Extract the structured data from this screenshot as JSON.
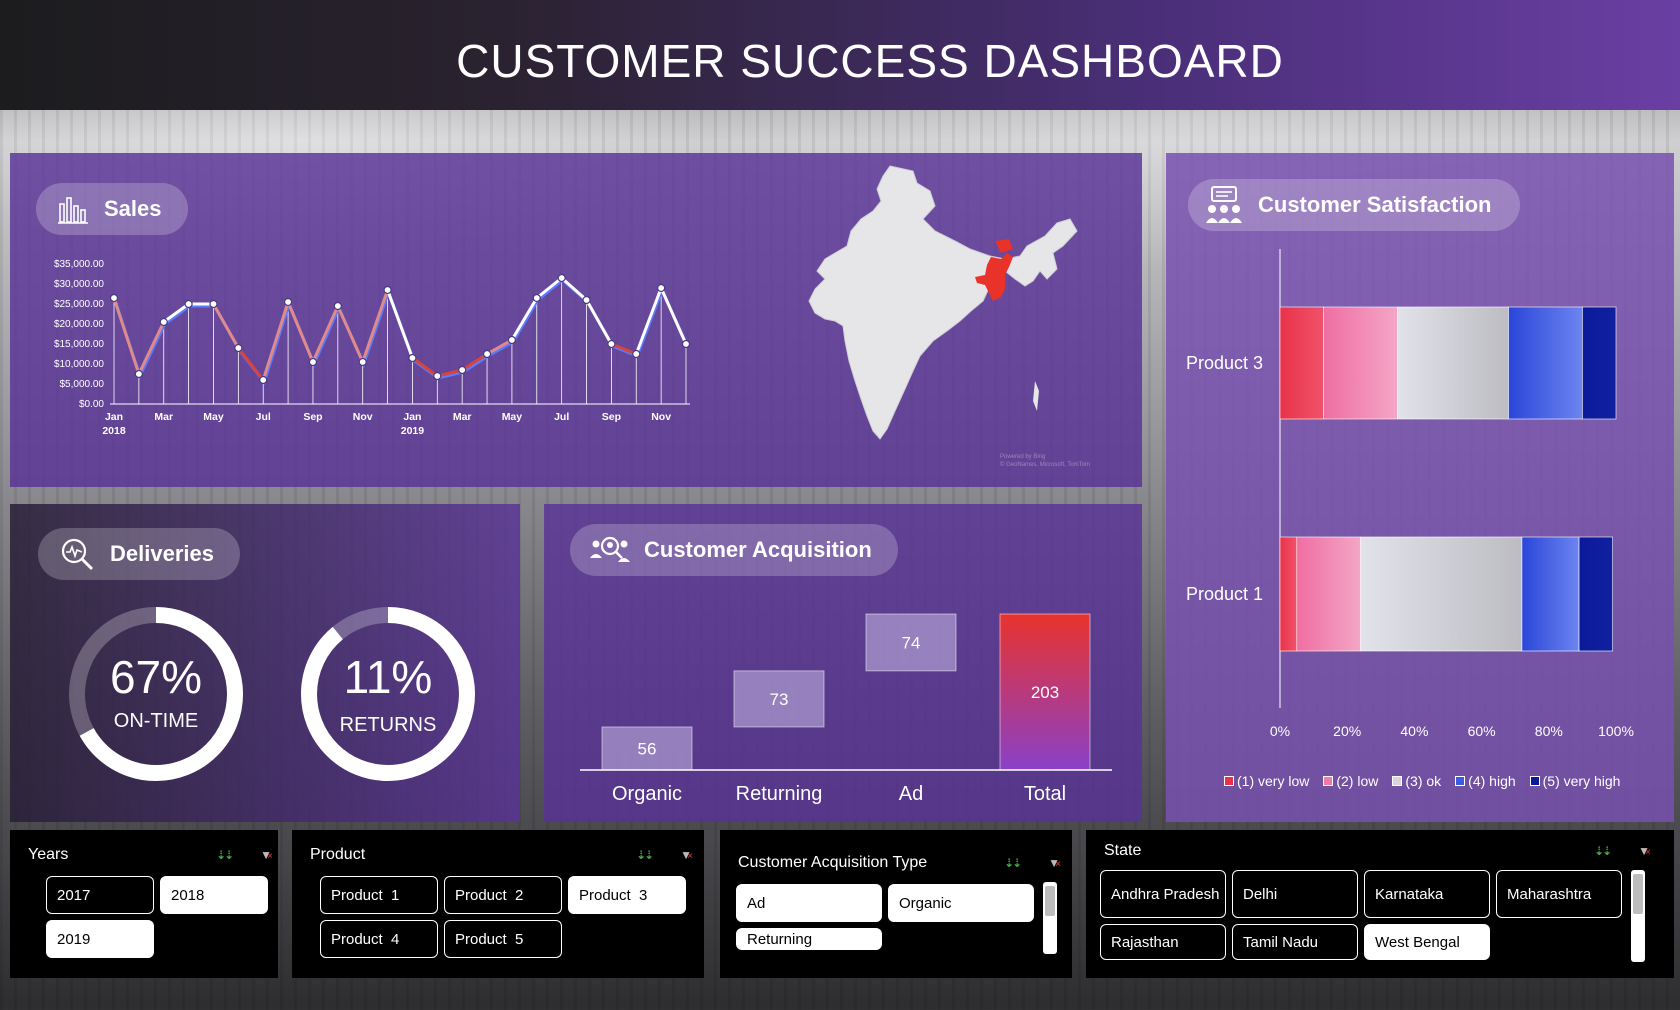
{
  "header": {
    "title": "CUSTOMER SUCCESS DASHBOARD"
  },
  "sales": {
    "title": "Sales",
    "icon": "bar-chart-icon",
    "chart_data": {
      "type": "line",
      "x_tick_labels": [
        "Jan\n2018",
        "Mar",
        "May",
        "Jul",
        "Sep",
        "Nov",
        "Jan\n2019",
        "Mar",
        "May",
        "Jul",
        "Sep",
        "Nov"
      ],
      "y_tick_labels": [
        "$35,000.00",
        "$30,000.00",
        "$25,000.00",
        "$20,000.00",
        "$15,000.00",
        "$10,000.00",
        "$5,000.00",
        "$0.00"
      ],
      "ylim": [
        0,
        35000
      ],
      "values": [
        26500,
        7500,
        20500,
        25000,
        25000,
        14000,
        6000,
        25500,
        10500,
        24500,
        10500,
        28500,
        11500,
        7000,
        8500,
        12500,
        16000,
        26500,
        31500,
        26000,
        15000,
        12500,
        29000,
        15000
      ]
    },
    "map_credit": "Powered by Bing\n© GeoNames, Microsoft, TomTom"
  },
  "deliveries": {
    "title": "Deliveries",
    "icon": "search-pulse-icon",
    "ontime": {
      "value": "67%",
      "label": "ON-TIME",
      "fraction": 0.67
    },
    "returns": {
      "value": "11%",
      "label": "RETURNS",
      "fraction": 0.89
    }
  },
  "acquisition": {
    "title": "Customer Acquisition",
    "icon": "users-search-icon",
    "chart_data": {
      "type": "bar",
      "subtype": "waterfall",
      "categories": [
        "Organic",
        "Returning",
        "Ad",
        "Total"
      ],
      "values": [
        56,
        73,
        74,
        203
      ],
      "labels": [
        "56",
        "73",
        "74",
        "203"
      ]
    }
  },
  "satisfaction": {
    "title": "Customer Satisfaction",
    "icon": "presentation-users-icon",
    "chart_data": {
      "type": "bar",
      "subtype": "stacked-100-horizontal",
      "categories": [
        "Product 3",
        "Product 1"
      ],
      "series": [
        {
          "name": "(1) very low",
          "values": [
            13,
            5
          ]
        },
        {
          "name": "(2) low",
          "values": [
            22,
            19
          ]
        },
        {
          "name": "(3) ok",
          "values": [
            33,
            48
          ]
        },
        {
          "name": "(4) high",
          "values": [
            22,
            17
          ]
        },
        {
          "name": "(5) very high",
          "values": [
            10,
            10
          ]
        }
      ],
      "x_tick_labels": [
        "0%",
        "20%",
        "40%",
        "60%",
        "80%",
        "100%"
      ],
      "colors": [
        "#e8324a",
        "#f07aa8",
        "#d6d6dc",
        "#3b5ce0",
        "#0a1a9a"
      ]
    }
  },
  "slicers": {
    "years": {
      "title": "Years",
      "items": [
        "2017",
        "2018",
        "2019"
      ],
      "selected": [
        "2018",
        "2019"
      ]
    },
    "product": {
      "title": "Product",
      "items": [
        "Product  1",
        "Product  2",
        "Product  3",
        "Product  4",
        "Product  5"
      ],
      "selected": [
        "Product  3"
      ]
    },
    "acq_type": {
      "title": "Customer Acquisition Type",
      "items": [
        "Ad",
        "Organic",
        "Returning"
      ],
      "selected": [
        "Ad",
        "Organic",
        "Returning"
      ]
    },
    "state": {
      "title": "State",
      "items": [
        "Andhra Pradesh",
        "Delhi",
        "Karnataka",
        "Maharashtra",
        "Rajasthan",
        "Tamil Nadu",
        "West Bengal"
      ],
      "selected": [
        "West Bengal"
      ]
    }
  }
}
